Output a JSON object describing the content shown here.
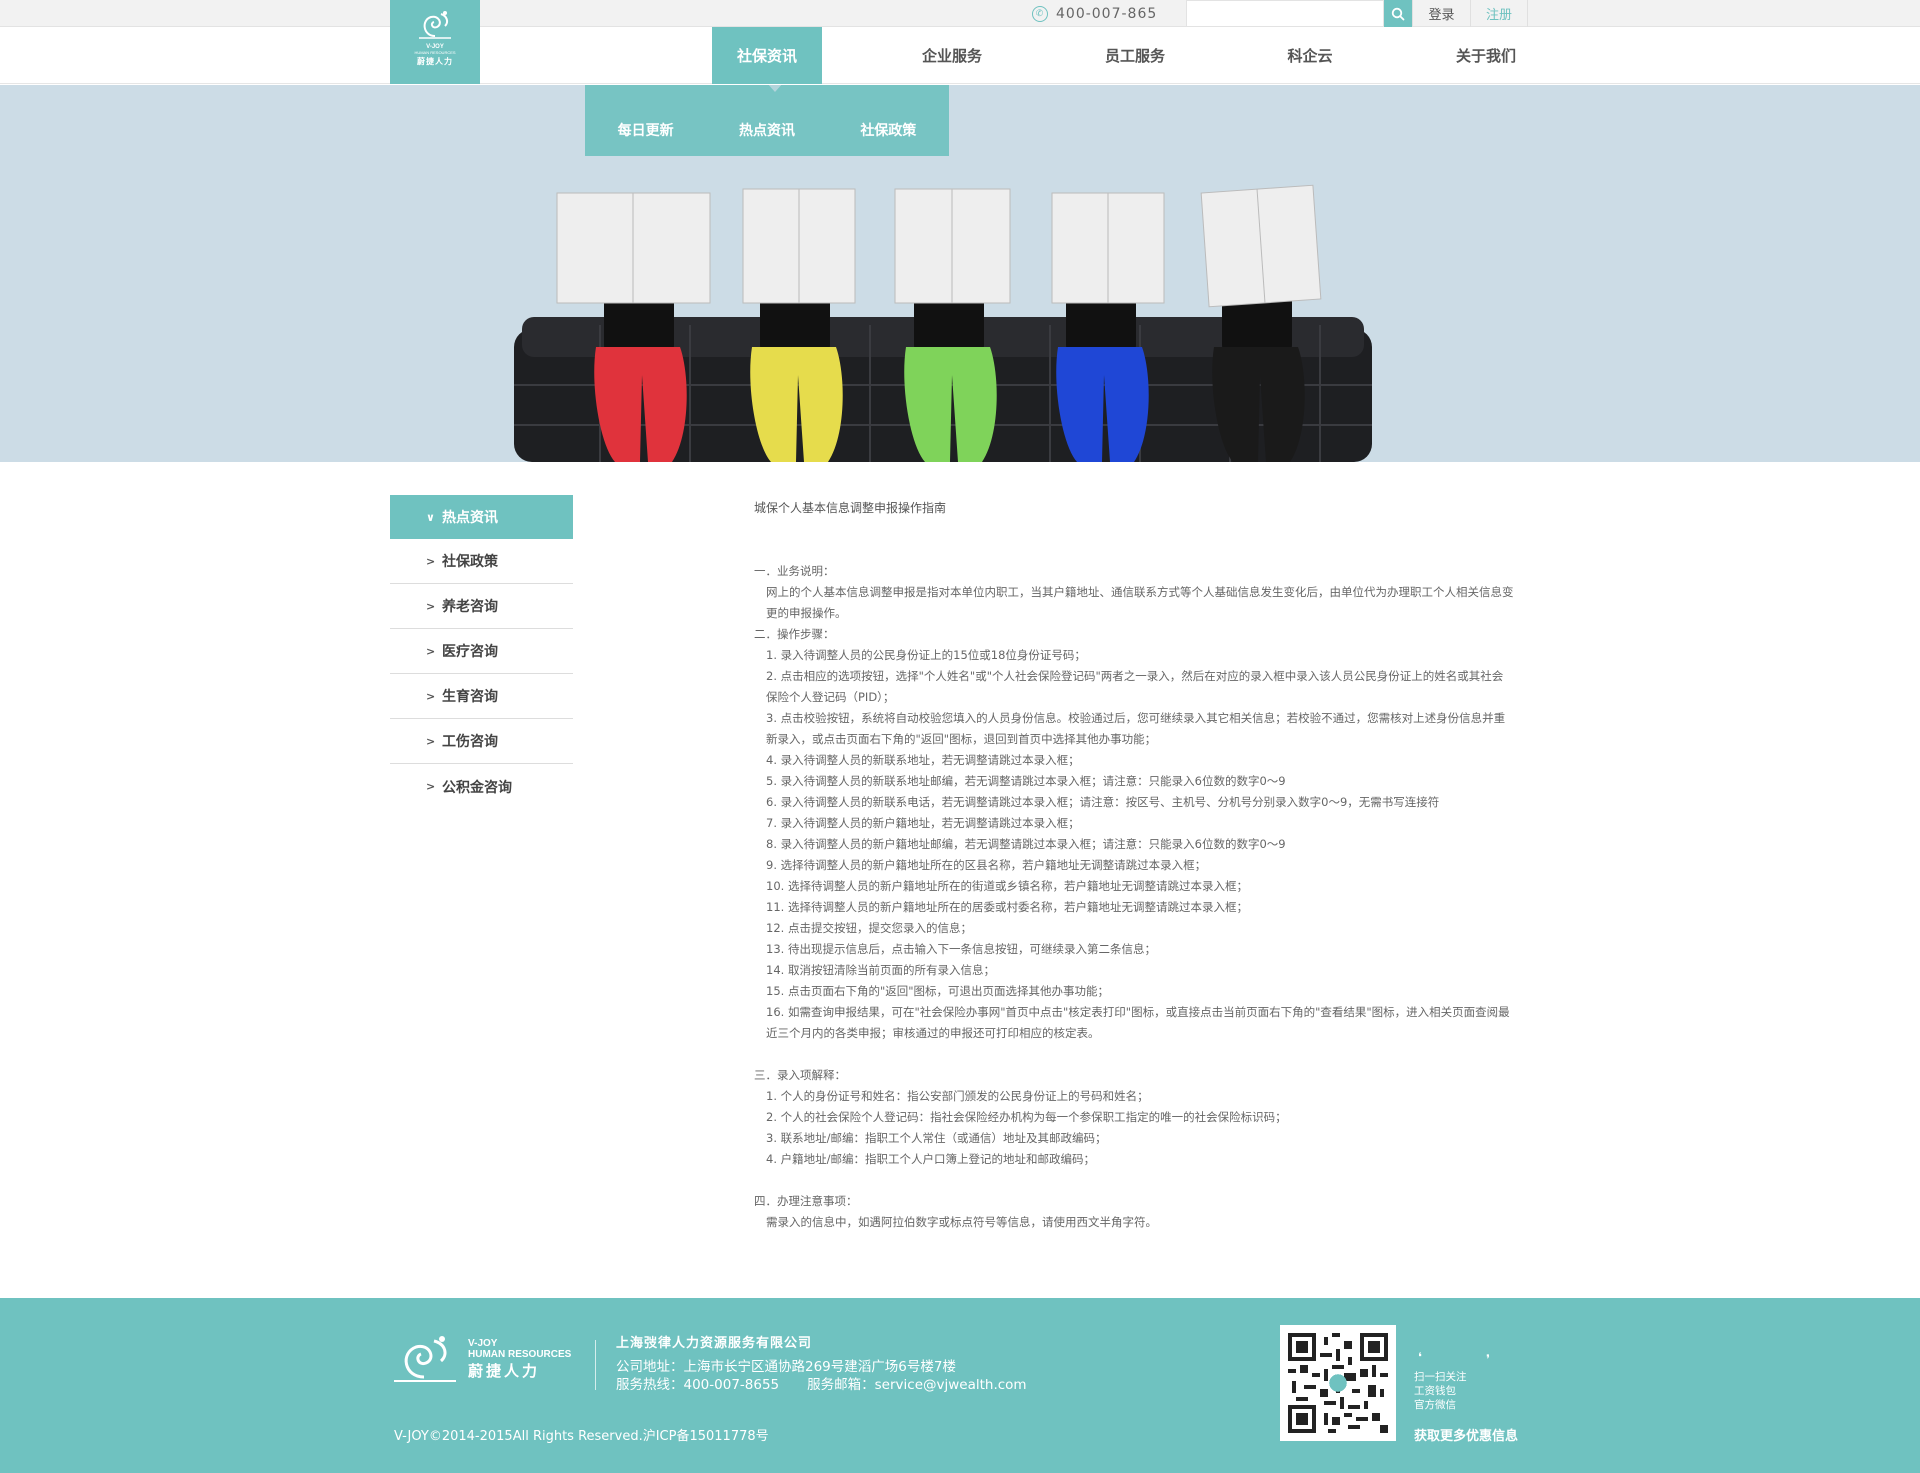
{
  "topbar": {
    "phone": "400-007-865",
    "search_placeholder": "",
    "login": "登录",
    "register": "注册"
  },
  "logo": {
    "en": "V-JOY",
    "sub": "HUMAN RESOURCES",
    "cn": "蔚捷人力"
  },
  "nav": {
    "items": [
      {
        "label": "社保资讯",
        "active": true
      },
      {
        "label": "企业服务"
      },
      {
        "label": "员工服务"
      },
      {
        "label": "科企云"
      },
      {
        "label": "关于我们"
      }
    ],
    "dropdown": [
      "每日更新",
      "热点资讯",
      "社保政策"
    ]
  },
  "sidebar": {
    "head": "热点资讯",
    "items": [
      "社保政策",
      "养老咨询",
      "医疗咨询",
      "生育咨询",
      "工伤咨询",
      "公积金咨询"
    ]
  },
  "article": {
    "title": "城保个人基本信息调整申报操作指南",
    "s1_title": "一．业务说明：",
    "s1_body": "网上的个人基本信息调整申报是指对本单位内职工，当其户籍地址、通信联系方式等个人基础信息发生变化后，由单位代为办理职工个人相关信息变更的申报操作。",
    "s2_title": "二．操作步骤：",
    "s2_steps": [
      "1. 录入待调整人员的公民身份证上的15位或18位身份证号码；",
      "2. 点击相应的选项按钮，选择\"个人姓名\"或\"个人社会保险登记码\"两者之一录入，然后在对应的录入框中录入该人员公民身份证上的姓名或其社会保险个人登记码（PID）；",
      "3. 点击校验按钮，系统将自动校验您填入的人员身份信息。校验通过后，您可继续录入其它相关信息；若校验不通过，您需核对上述身份信息并重新录入，或点击页面右下角的\"返回\"图标，退回到首页中选择其他办事功能；",
      "4. 录入待调整人员的新联系地址，若无调整请跳过本录入框；",
      "5. 录入待调整人员的新联系地址邮编，若无调整请跳过本录入框；请注意：只能录入6位数的数字0～9",
      "6. 录入待调整人员的新联系电话，若无调整请跳过本录入框；请注意：按区号、主机号、分机号分别录入数字0～9，无需书写连接符",
      "7. 录入待调整人员的新户籍地址，若无调整请跳过本录入框；",
      "8. 录入待调整人员的新户籍地址邮编，若无调整请跳过本录入框；请注意：只能录入6位数的数字0～9",
      "9. 选择待调整人员的新户籍地址所在的区县名称，若户籍地址无调整请跳过本录入框；",
      "10. 选择待调整人员的新户籍地址所在的街道或乡镇名称，若户籍地址无调整请跳过本录入框；",
      "11. 选择待调整人员的新户籍地址所在的居委或村委名称，若户籍地址无调整请跳过本录入框；",
      "12. 点击提交按钮，提交您录入的信息；",
      "13. 待出现提示信息后，点击输入下一条信息按钮，可继续录入第二条信息；",
      "14. 取消按钮清除当前页面的所有录入信息；",
      "15. 点击页面右下角的\"返回\"图标，可退出页面选择其他办事功能；",
      "16. 如需查询申报结果，可在\"社会保险办事网\"首页中点击\"核定表打印\"图标，或直接点击当前页面右下角的\"查看结果\"图标，进入相关页面查阅最近三个月内的各类申报；审核通过的申报还可打印相应的核定表。"
    ],
    "s3_title": "三．录入项解释：",
    "s3_items": [
      "1. 个人的身份证号和姓名：指公安部门颁发的公民身份证上的号码和姓名；",
      "2. 个人的社会保险个人登记码：指社会保险经办机构为每一个参保职工指定的唯一的社会保险标识码；",
      "3. 联系地址/邮编：指职工个人常住（或通信）地址及其邮政编码；",
      "4. 户籍地址/邮编：指职工个人户口簿上登记的地址和邮政编码；"
    ],
    "s4_title": "四．办理注意事项：",
    "s4_body": "需录入的信息中，如遇阿拉伯数字或标点符号等信息，请使用西文半角字符。"
  },
  "footer": {
    "logo_en": "V-JOY",
    "logo_sub": "HUMAN RESOURCES",
    "logo_cn": "蔚捷人力",
    "company": "上海弢律人力资源服务有限公司",
    "address": "公司地址：上海市长宁区通协路269号建滔广场6号楼7楼",
    "hotline": "服务热线：400-007-8655",
    "email": "服务邮箱：service@vjwealth.com",
    "copyright": "V-JOY©2014-2015All Rights Reserved.沪ICP备15011778号",
    "qr_lines": [
      "扫一扫关注",
      "工资钱包",
      "官方微信"
    ],
    "qr_more": "获取更多优惠信息"
  },
  "colors": {
    "accent": "#6fc2c0",
    "banner_bg": "#ccdce6"
  }
}
